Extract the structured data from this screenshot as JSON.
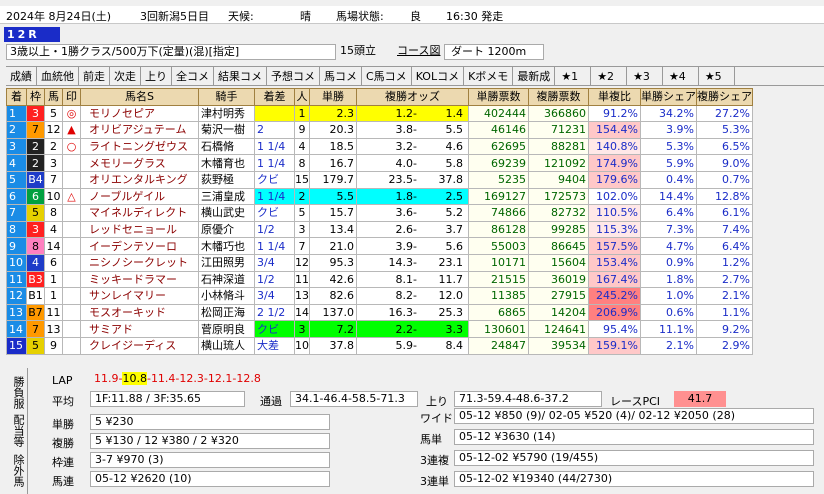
{
  "header": {
    "date": "2024年 8月24日(土)",
    "kaisai": "3回新潟5日目",
    "weather_label": "天候:",
    "weather": "晴",
    "track_label": "馬場状態:",
    "track": "良",
    "post_time": "16:30 発走",
    "race_no": "12R",
    "condition": "3歳以上・1勝クラス/500万下(定量)(混)[指定]",
    "field_size": "15頭立",
    "course_link": "コース図",
    "course": "ダート 1200m"
  },
  "tabs": [
    "成績",
    "血統他",
    "前走",
    "次走",
    "上り",
    "全コメ",
    "結果コメ",
    "予想コメ",
    "馬コメ",
    "C馬コメ",
    "KOLコメ",
    "Kボメモ",
    "最新成",
    "★1",
    "★2",
    "★3",
    "★4",
    "★5"
  ],
  "columns": [
    "着",
    "枠",
    "馬",
    "印",
    "馬名S",
    "騎手",
    "着差",
    "人",
    "単勝",
    "複勝オッズ",
    "単勝票数",
    "複勝票数",
    "単複比",
    "単勝シェア",
    "複勝シェア"
  ],
  "colors": {
    "waku": [
      "#ffffff",
      "#222222",
      "#ff0000",
      "#1e3cc8",
      "#e6c800",
      "#00a040",
      "#ff8c00",
      "#ff80c0"
    ],
    "header_bg": "#ecd9b0",
    "yellow": "#ffff00",
    "cyan": "#00ffff",
    "green": "#00ff00",
    "pink": "#ff9999",
    "pink_light": "#ffd0d0"
  },
  "rows": [
    {
      "rank": "1",
      "waku": "3",
      "num": "5",
      "mark": "◎",
      "name": "モリノセピア",
      "jockey": "津村明秀",
      "margin": "",
      "ninki": "1",
      "tan": "2.3",
      "fuku_lo": "1.2-",
      "fuku_hi": "1.4",
      "tan_votes": "402444",
      "fuku_votes": "366860",
      "ratio": "91.2%",
      "tan_share": "34.2%",
      "fuku_share": "27.2%",
      "rankbg": "#1a8ce6"
    },
    {
      "rank": "2",
      "waku": "7",
      "num": "12",
      "mark": "▲",
      "name": "オリビアジュテーム",
      "jockey": "菊沢一樹",
      "margin": "2",
      "ninki": "9",
      "tan": "20.3",
      "fuku_lo": "3.8-",
      "fuku_hi": "5.5",
      "tan_votes": "46146",
      "fuku_votes": "71231",
      "ratio": "154.4%",
      "tan_share": "3.9%",
      "fuku_share": "5.3%",
      "rankbg": "#1a8ce6"
    },
    {
      "rank": "3",
      "waku": "2",
      "num": "2",
      "mark": "○",
      "name": "ライトニングゼウス",
      "jockey": "石橋脩",
      "margin": "1 1/4",
      "ninki": "4",
      "tan": "18.5",
      "fuku_lo": "3.2-",
      "fuku_hi": "4.6",
      "tan_votes": "62695",
      "fuku_votes": "88281",
      "ratio": "140.8%",
      "tan_share": "5.3%",
      "fuku_share": "6.5%",
      "rankbg": "#1a8ce6"
    },
    {
      "rank": "4",
      "waku": "2",
      "num": "3",
      "mark": "",
      "name": "メモリーグラス",
      "jockey": "木幡育也",
      "margin": "1 1/4",
      "ninki": "8",
      "tan": "16.7",
      "fuku_lo": "4.0-",
      "fuku_hi": "5.8",
      "tan_votes": "69239",
      "fuku_votes": "121092",
      "ratio": "174.9%",
      "tan_share": "5.9%",
      "fuku_share": "9.0%",
      "rankbg": "#1a8ce6"
    },
    {
      "rank": "5",
      "waku": "B4",
      "num": "7",
      "mark": "",
      "name": "オリエンタルキング",
      "jockey": "荻野極",
      "margin": "クビ",
      "ninki": "15",
      "tan": "179.7",
      "fuku_lo": "23.5-",
      "fuku_hi": "37.8",
      "tan_votes": "5235",
      "fuku_votes": "9404",
      "ratio": "179.6%",
      "tan_share": "0.4%",
      "fuku_share": "0.7%",
      "rankbg": "#1a8ce6"
    },
    {
      "rank": "6",
      "waku": "6",
      "num": "10",
      "mark": "△",
      "name": "ノーブルゲイル",
      "jockey": "三浦皇成",
      "margin": "1 1/4",
      "ninki": "2",
      "tan": "5.5",
      "fuku_lo": "1.8-",
      "fuku_hi": "2.5",
      "tan_votes": "169127",
      "fuku_votes": "172573",
      "ratio": "102.0%",
      "tan_share": "14.4%",
      "fuku_share": "12.8%",
      "rankbg": "#1a8ce6"
    },
    {
      "rank": "7",
      "waku": "5",
      "num": "8",
      "mark": "",
      "name": "マイネルディレクト",
      "jockey": "横山武史",
      "margin": "クビ",
      "ninki": "5",
      "tan": "15.7",
      "fuku_lo": "3.6-",
      "fuku_hi": "5.2",
      "tan_votes": "74866",
      "fuku_votes": "82732",
      "ratio": "110.5%",
      "tan_share": "6.4%",
      "fuku_share": "6.1%",
      "rankbg": "#1a8ce6"
    },
    {
      "rank": "8",
      "waku": "3",
      "num": "4",
      "mark": "",
      "name": "レッドセニョール",
      "jockey": "原優介",
      "margin": "1/2",
      "ninki": "3",
      "tan": "13.4",
      "fuku_lo": "2.6-",
      "fuku_hi": "3.7",
      "tan_votes": "86128",
      "fuku_votes": "99285",
      "ratio": "115.3%",
      "tan_share": "7.3%",
      "fuku_share": "7.4%",
      "rankbg": "#1a8ce6"
    },
    {
      "rank": "9",
      "waku": "8",
      "num": "14",
      "mark": "",
      "name": "イーデンテソーロ",
      "jockey": "木幡巧也",
      "margin": "1 1/4",
      "ninki": "7",
      "tan": "21.0",
      "fuku_lo": "3.9-",
      "fuku_hi": "5.6",
      "tan_votes": "55003",
      "fuku_votes": "86645",
      "ratio": "157.5%",
      "tan_share": "4.7%",
      "fuku_share": "6.4%",
      "rankbg": "#1a8ce6"
    },
    {
      "rank": "10",
      "waku": "4",
      "num": "6",
      "mark": "",
      "name": "ニシノシークレット",
      "jockey": "江田照男",
      "margin": "3/4",
      "ninki": "12",
      "tan": "95.3",
      "fuku_lo": "14.3-",
      "fuku_hi": "23.1",
      "tan_votes": "10171",
      "fuku_votes": "15604",
      "ratio": "153.4%",
      "tan_share": "0.9%",
      "fuku_share": "1.2%",
      "rankbg": "#1a8ce6"
    },
    {
      "rank": "11",
      "waku": "B3",
      "num": "1",
      "mark": "",
      "name": "ミッキードラマー",
      "jockey": "石神深道",
      "margin": "1/2",
      "ninki": "11",
      "tan": "42.6",
      "fuku_lo": "8.1-",
      "fuku_hi": "11.7",
      "tan_votes": "21515",
      "fuku_votes": "36019",
      "ratio": "167.4%",
      "tan_share": "1.8%",
      "fuku_share": "2.7%",
      "rankbg": "#1a8ce6"
    },
    {
      "rank": "12",
      "waku": "B1",
      "num": "1",
      "mark": "",
      "name": "サンレイマリー",
      "jockey": "小林脩斗",
      "margin": "3/4",
      "ninki": "13",
      "tan": "82.6",
      "fuku_lo": "8.2-",
      "fuku_hi": "12.0",
      "tan_votes": "11385",
      "fuku_votes": "27915",
      "ratio": "245.2%",
      "tan_share": "1.0%",
      "fuku_share": "2.1%",
      "rankbg": "#1a8ce6"
    },
    {
      "rank": "13",
      "waku": "B7",
      "num": "11",
      "mark": "",
      "name": "モスオーキッド",
      "jockey": "松岡正海",
      "margin": "2 1/2",
      "ninki": "14",
      "tan": "137.0",
      "fuku_lo": "16.3-",
      "fuku_hi": "25.3",
      "tan_votes": "6865",
      "fuku_votes": "14204",
      "ratio": "206.9%",
      "tan_share": "0.6%",
      "fuku_share": "1.1%",
      "rankbg": "#1a8ce6"
    },
    {
      "rank": "14",
      "waku": "7",
      "num": "13",
      "mark": "",
      "name": "サミアド",
      "jockey": "菅原明良",
      "margin": "クビ",
      "ninki": "3",
      "tan": "7.2",
      "fuku_lo": "2.2-",
      "fuku_hi": "3.3",
      "tan_votes": "130601",
      "fuku_votes": "124641",
      "ratio": "95.4%",
      "tan_share": "11.1%",
      "fuku_share": "9.2%",
      "rankbg": "#1a8ce6"
    },
    {
      "rank": "15",
      "waku": "5",
      "num": "9",
      "mark": "",
      "name": "クレイジーディス",
      "jockey": "横山琉人",
      "margin": "大差",
      "ninki": "10",
      "tan": "37.8",
      "fuku_lo": "5.9-",
      "fuku_hi": "8.4",
      "tan_votes": "24847",
      "fuku_votes": "39534",
      "ratio": "159.1%",
      "tan_share": "2.1%",
      "fuku_share": "2.9%",
      "rankbg": "#1a2cc8"
    }
  ],
  "side_labels": [
    "勝負服",
    "配当等",
    "除外馬"
  ],
  "lap": {
    "label": "LAP",
    "values": [
      "11.9-",
      "10.8",
      "-11.4-12.3-12.1-12.8"
    ]
  },
  "avg": {
    "label": "平均",
    "value": "1F:11.88 / 3F:35.65",
    "tsuka_label": "通過",
    "tsuka": "34.1-46.4-58.5-71.3"
  },
  "agari": {
    "label": "上り",
    "value": "71.3-59.4-48.6-37.2",
    "pci_label": "レースPCI",
    "pci": "41.7"
  },
  "payouts": [
    {
      "label": "単勝",
      "value": "5 ¥230"
    },
    {
      "label": "複勝",
      "value": "5 ¥130 / 12 ¥380 / 2 ¥320"
    },
    {
      "label": "枠連",
      "value": "3-7 ¥970 (3)"
    },
    {
      "label": "馬連",
      "value": "05-12 ¥2620 (10)"
    }
  ],
  "payouts_right": [
    {
      "label": "ワイド",
      "value": "05-12 ¥850 (9)/ 02-05 ¥520 (4)/ 02-12 ¥2050 (28)"
    },
    {
      "label": "馬単",
      "value": "05-12 ¥3630 (14)"
    },
    {
      "label": "3連複",
      "value": "05-12-02 ¥5790 (19/455)"
    },
    {
      "label": "3連単",
      "value": "05-12-02 ¥19340 (44/2730)"
    }
  ]
}
